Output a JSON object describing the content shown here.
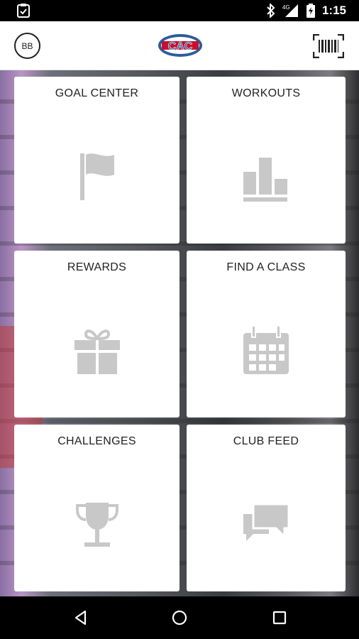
{
  "status_bar": {
    "time": "1:15",
    "network": "4G",
    "icons": [
      "clipboard-check-icon",
      "bluetooth-icon",
      "signal-icon",
      "battery-icon"
    ]
  },
  "app_bar": {
    "avatar_initials": "BB",
    "logo_text": "CAC",
    "barcode_icon": "barcode-scanner-icon"
  },
  "tiles": [
    {
      "label": "GOAL CENTER",
      "icon": "flag-icon"
    },
    {
      "label": "WORKOUTS",
      "icon": "bar-chart-icon"
    },
    {
      "label": "REWARDS",
      "icon": "gift-icon"
    },
    {
      "label": "FIND A CLASS",
      "icon": "calendar-icon"
    },
    {
      "label": "CHALLENGES",
      "icon": "trophy-icon"
    },
    {
      "label": "CLUB FEED",
      "icon": "chat-bubbles-icon"
    }
  ],
  "colors": {
    "icon_gray": "#c8c8c8",
    "tile_bg": "#ffffff",
    "logo_blue": "#2b5d9b",
    "logo_red": "#c8102e"
  },
  "nav_bar": {
    "buttons": [
      "back-icon",
      "home-icon",
      "recents-icon"
    ]
  }
}
